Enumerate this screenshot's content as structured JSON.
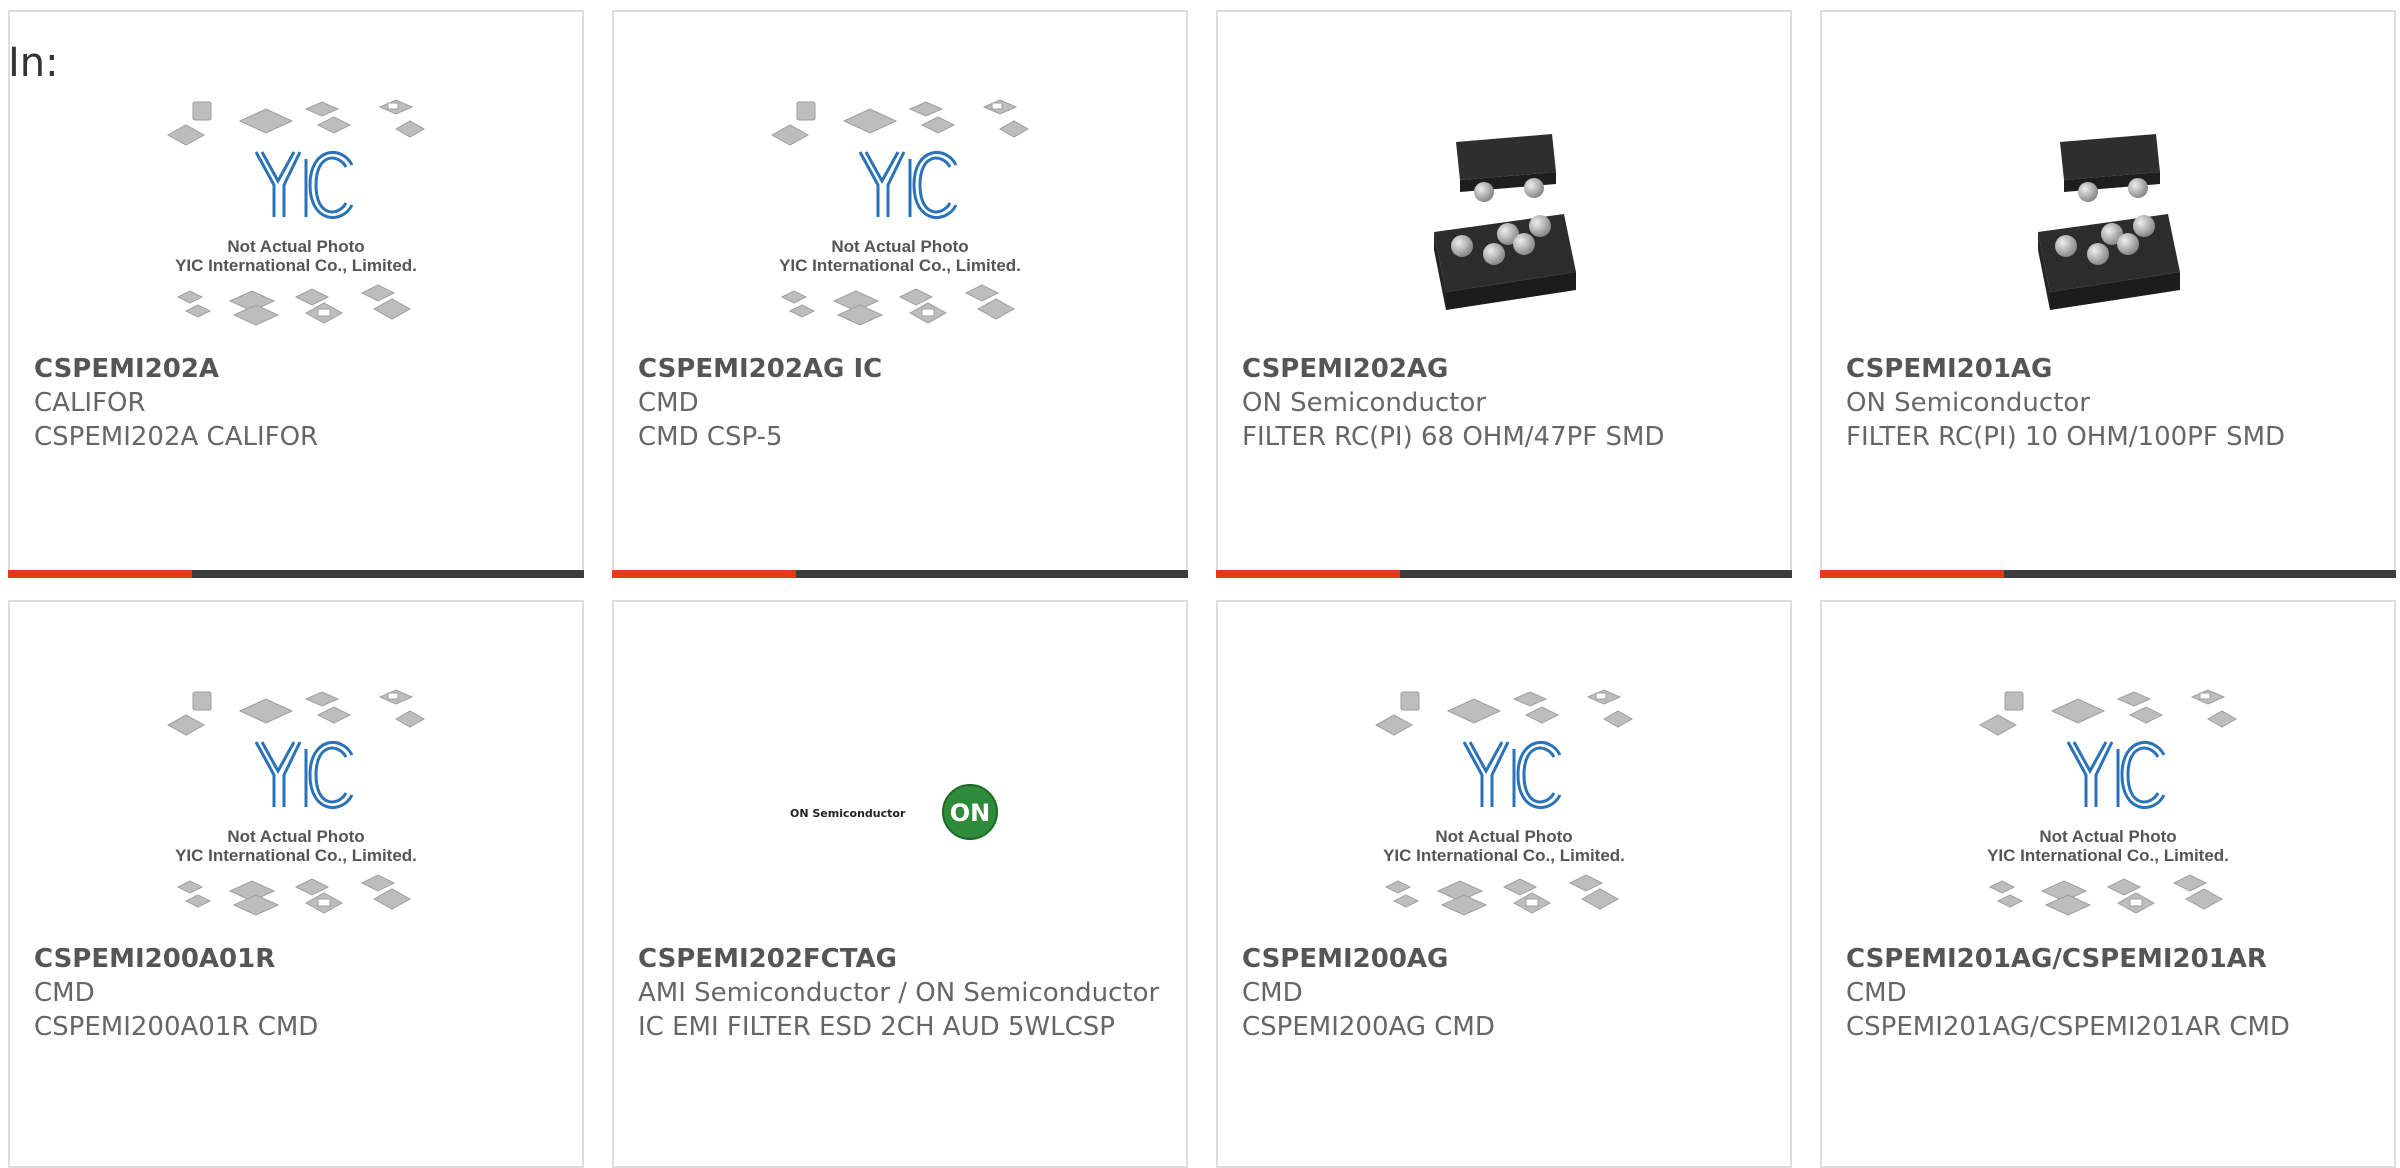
{
  "header": {
    "in_label": "In:"
  },
  "placeholder": {
    "line1": "Not Actual Photo",
    "line2": "YIC International Co., Limited."
  },
  "on_logo_text": "ON Semiconductor",
  "on_logo_mark": "ON",
  "colors": {
    "accent": "#e03c1a",
    "bar": "#3d3d3d",
    "yic_blue": "#2a73b8",
    "on_green": "#2e8b3a"
  },
  "products": [
    {
      "part": "CSPEMI202A",
      "mfr": "CALIFOR",
      "desc": "CSPEMI202A CALIFOR",
      "image": "yic-placeholder"
    },
    {
      "part": "CSPEMI202AG IC",
      "mfr": "CMD",
      "desc": "CMD CSP-5",
      "image": "yic-placeholder"
    },
    {
      "part": "CSPEMI202AG",
      "mfr": "ON Semiconductor",
      "desc": "FILTER RC(PI) 68 OHM/47PF SMD",
      "image": "csp-chip"
    },
    {
      "part": "CSPEMI201AG",
      "mfr": "ON Semiconductor",
      "desc": "FILTER RC(PI) 10 OHM/100PF SMD",
      "image": "csp-chip"
    },
    {
      "part": "CSPEMI200A01R",
      "mfr": "CMD",
      "desc": "CSPEMI200A01R CMD",
      "image": "yic-placeholder"
    },
    {
      "part": "CSPEMI202FCTAG",
      "mfr": "AMI Semiconductor / ON Semiconductor",
      "desc": "IC EMI FILTER ESD 2CH AUD 5WLCSP",
      "image": "on-logo"
    },
    {
      "part": "CSPEMI200AG",
      "mfr": "CMD",
      "desc": "CSPEMI200AG CMD",
      "image": "yic-placeholder"
    },
    {
      "part": "CSPEMI201AG/CSPEMI201AR",
      "mfr": "CMD",
      "desc": "CSPEMI201AG/CSPEMI201AR CMD",
      "image": "yic-placeholder"
    }
  ]
}
